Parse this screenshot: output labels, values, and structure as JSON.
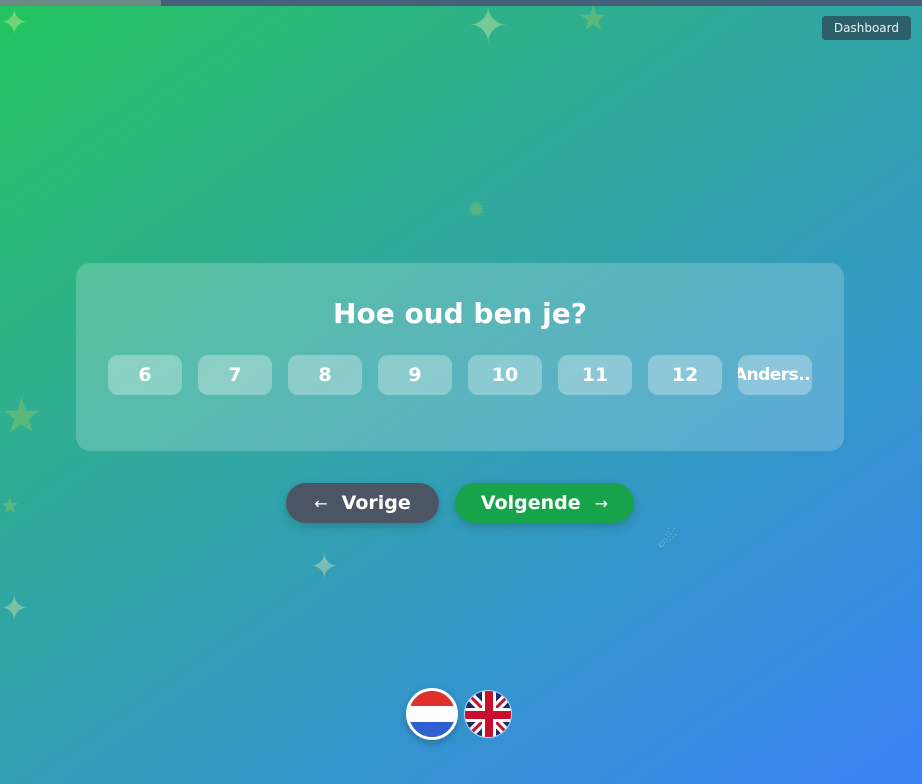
{
  "header": {
    "dashboard_label": "Dashboard"
  },
  "progress": {
    "fraction": 0.175
  },
  "question": {
    "title": "Hoe oud ben je?",
    "options": [
      "6",
      "7",
      "8",
      "9",
      "10",
      "11",
      "12",
      "Anders..."
    ]
  },
  "navigation": {
    "prev_label": "Vorige",
    "next_label": "Volgende",
    "prev_icon": "arrow-left-icon",
    "next_icon": "arrow-right-icon"
  },
  "languages": [
    {
      "code": "nl",
      "icon": "dutch-flag-icon",
      "selected": true
    },
    {
      "code": "en",
      "icon": "uk-flag-icon",
      "selected": false
    }
  ],
  "colors": {
    "next_button": "#16a34a",
    "prev_button": "#4b5563",
    "background_start": "#22c55e",
    "background_end": "#3b82f6"
  }
}
